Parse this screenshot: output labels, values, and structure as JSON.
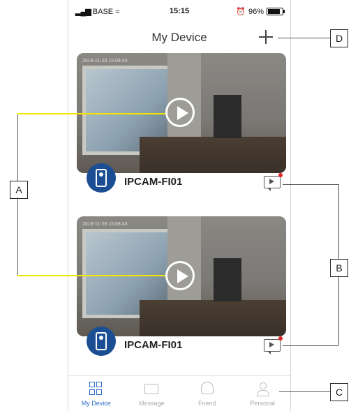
{
  "status": {
    "carrier": "BASE",
    "time": "15:15",
    "battery": "96%"
  },
  "header": {
    "title": "My Device"
  },
  "cameras": [
    {
      "name": "IPCAM-FI01",
      "timestamp": "2018-11-28 15:08:43"
    },
    {
      "name": "IPCAM-FI01",
      "timestamp": "2018-11-28 15:08:43"
    }
  ],
  "tabs": [
    {
      "label": "My Device"
    },
    {
      "label": "Message"
    },
    {
      "label": "Friend"
    },
    {
      "label": "Personal"
    }
  ],
  "callouts": {
    "a": "A",
    "b": "B",
    "c": "C",
    "d": "D"
  },
  "colors": {
    "accent": "#2a6ac9",
    "avatar": "#1b4e92",
    "notify": "#e02525",
    "pointer": "#f2e600"
  }
}
